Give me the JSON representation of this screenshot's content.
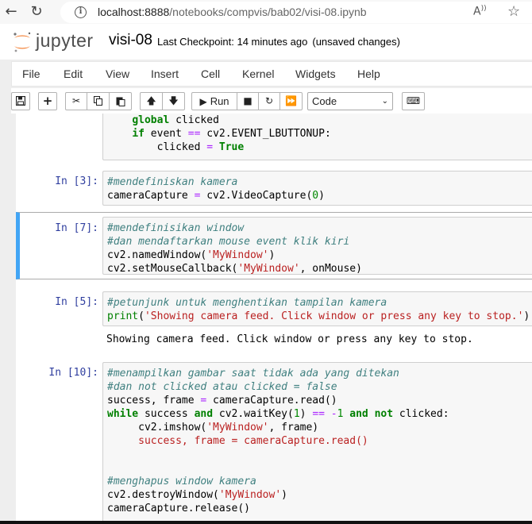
{
  "browser": {
    "url_host": "localhost:8888",
    "url_path": "/notebooks/compvis/bab02/visi-08.ipynb"
  },
  "header": {
    "logo_text": "jupyter",
    "notebook_name": "visi-08",
    "checkpoint_label": "Last Checkpoint:",
    "checkpoint_time": "14 minutes ago",
    "status": "(unsaved changes)"
  },
  "menu": [
    "File",
    "Edit",
    "View",
    "Insert",
    "Cell",
    "Kernel",
    "Widgets",
    "Help"
  ],
  "toolbar": {
    "run_label": "Run",
    "cell_type": "Code"
  },
  "cells": {
    "c0": {
      "lines": [
        "global clicked",
        "if event == cv2.EVENT_LBUTTONUP:",
        "    clicked = True"
      ]
    },
    "c1": {
      "prompt": "In [3]:",
      "lines": [
        "#mendefiniskan kamera",
        "cameraCapture = cv2.VideoCapture(0)"
      ]
    },
    "c2": {
      "prompt": "In [7]:",
      "lines": [
        "#mendefinisikan window",
        "#dan mendaftarkan mouse event klik kiri",
        "cv2.namedWindow('MyWindow')",
        "cv2.setMouseCallback('MyWindow', onMouse)"
      ]
    },
    "c3": {
      "prompt": "In [5]:",
      "lines": [
        "#petunjunk untuk menghentikan tampilan kamera",
        "print('Showing camera feed. Click window or press any key to stop.')"
      ],
      "output": "Showing camera feed. Click window or press any key to stop."
    },
    "c4": {
      "prompt": "In [10]:",
      "lines": [
        "#menampilkan gambar saat tidak ada yang ditekan",
        "#dan not clicked atau clicked = false",
        "success, frame = cameraCapture.read()",
        "while success and cv2.waitKey(1) == -1 and not clicked:",
        "     cv2.imshow('MyWindow', frame)",
        "     success, frame = cameraCapture.read()",
        "",
        "",
        "#menghapus window kamera",
        "cv2.destroyWindow('MyWindow')",
        "cameraCapture.release()"
      ]
    }
  },
  "colors": {
    "selected_border": "#42a5f5",
    "prompt": "#303f9f",
    "keyword": "#008000",
    "comment": "#408080",
    "string": "#ba2121"
  }
}
